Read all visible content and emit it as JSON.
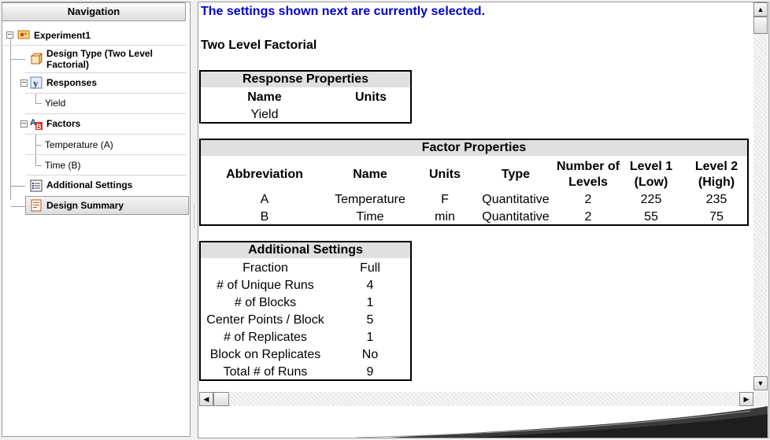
{
  "navigation": {
    "header": "Navigation",
    "items": [
      {
        "label": "Experiment1"
      },
      {
        "label": "Design Type (Two Level Factorial)"
      },
      {
        "label": "Responses"
      },
      {
        "label": "Yield"
      },
      {
        "label": "Factors"
      },
      {
        "label": "Temperature (A)"
      },
      {
        "label": "Time (B)"
      },
      {
        "label": "Additional Settings"
      },
      {
        "label": "Design Summary"
      }
    ]
  },
  "content": {
    "headline": "The settings shown next are currently selected.",
    "subtitle": "Two Level Factorial",
    "response_properties": {
      "title": "Response Properties",
      "columns": [
        "Name",
        "Units"
      ],
      "rows": [
        [
          "Yield",
          ""
        ]
      ]
    },
    "factor_properties": {
      "title": "Factor Properties",
      "columns": [
        "Abbreviation",
        "Name",
        "Units",
        "Type",
        "Number of Levels",
        "Level 1 (Low)",
        "Level 2 (High)"
      ],
      "rows": [
        [
          "A",
          "Temperature",
          "F",
          "Quantitative",
          "2",
          "225",
          "235"
        ],
        [
          "B",
          "Time",
          "min",
          "Quantitative",
          "2",
          "55",
          "75"
        ]
      ]
    },
    "additional_settings": {
      "title": "Additional Settings",
      "rows": [
        [
          "Fraction",
          "Full"
        ],
        [
          "# of Unique Runs",
          "4"
        ],
        [
          "# of Blocks",
          "1"
        ],
        [
          "Center Points / Block",
          "5"
        ],
        [
          "# of Replicates",
          "1"
        ],
        [
          "Block on Replicates",
          "No"
        ],
        [
          "Total # of Runs",
          "9"
        ]
      ]
    }
  },
  "colors": {
    "headline": "#0000cc",
    "table_header": "#e0e0e0"
  },
  "icons": [
    "expand-minus-icon",
    "experiment-icon",
    "design-type-icon",
    "responses-icon",
    "factors-icon",
    "settings-list-icon",
    "design-summary-icon",
    "scroll-up-arrow-icon",
    "scroll-down-arrow-icon",
    "scroll-left-arrow-icon",
    "scroll-right-arrow-icon"
  ]
}
